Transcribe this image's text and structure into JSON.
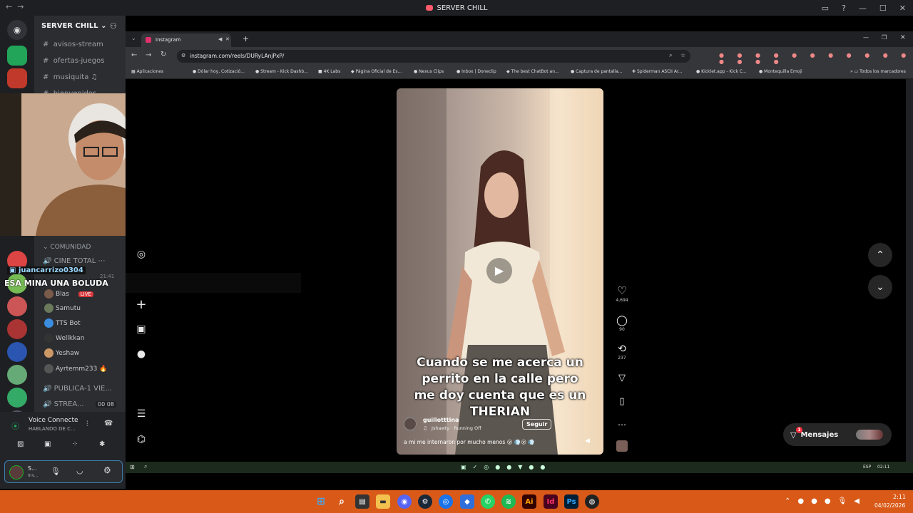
{
  "discord": {
    "window_title": "SERVER CHILL",
    "server_name": "SERVER CHILL",
    "channels": [
      "avisos-stream",
      "ofertas-juegos",
      "musiquita",
      "bienvenidos"
    ],
    "category": "COMUNIDAD",
    "voice_channel": "CINE TOTAL",
    "chat_user": "juancarrizo0304",
    "chat_time": "21:41",
    "chat_message": "ESA MINA UNA BOLUDA",
    "voice_users": [
      {
        "name": "Blas",
        "badge": "LIVE"
      },
      {
        "name": "Samutu"
      },
      {
        "name": "TTS Bot"
      },
      {
        "name": "Wellkkan"
      },
      {
        "name": "Yeshaw"
      },
      {
        "name": "Ayrtemm233"
      }
    ],
    "voice_channel_2": "PUBLICA-1 VIE...",
    "voice_channel_3": "STREA...",
    "voice_channel_3_counts": "00  08",
    "voice_status": "Voice Connected",
    "voice_substatus": "HABLANDO DE C...",
    "user_short": "S...",
    "user_sub": "Inv..."
  },
  "browser": {
    "tab_title": "Instagram",
    "url": "instagram.com/reels/DURyLAnjPxP/",
    "bookmarks": [
      "Aplicaciones",
      "Dólar hoy, Cotizació...",
      "Stream - Kick Dashb...",
      "4K Labs",
      "Página Oficial de Es...",
      "Nexus Clips",
      "Inbox | Doneclip",
      "The best ChatBot an...",
      "Captura de pantalla...",
      "Spiderman ASCII Ar...",
      "Kicklet.app - Kick C...",
      "Montequilla Emoji"
    ],
    "all_bookmarks": "Todos los marcadores"
  },
  "instagram": {
    "caption_lines": [
      "Cuando se me acerca un",
      "perrito en la calle pero",
      "me doy cuenta que es un",
      "THERIAN"
    ],
    "author": "guillotttina",
    "music": "Jshawty · Running Off",
    "follow_label": "Seguir",
    "description": "a mi me internaron por mucho menos 😮 💨😮 💨",
    "likes": "4,694",
    "comments": "90",
    "reposts": "237",
    "messages_label": "Mensajes",
    "messages_badge": "1"
  },
  "inner_taskbar": {
    "lang": "ESP",
    "time": "02:11"
  },
  "taskbar": {
    "time": "2:11",
    "date": "04/02/2026",
    "accent": "#d95a18"
  }
}
